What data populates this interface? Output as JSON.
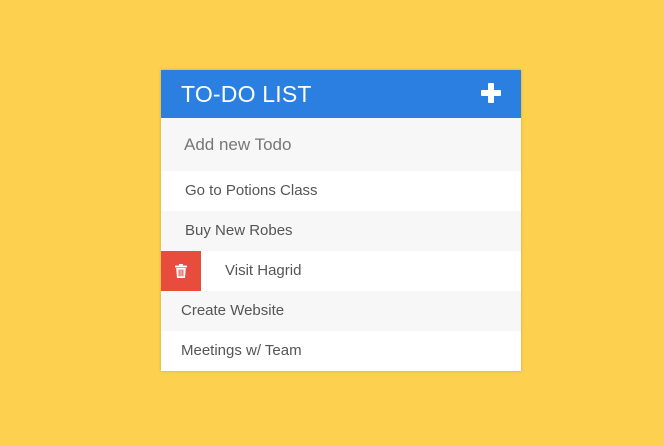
{
  "header": {
    "title": "TO-DO LIST",
    "add_icon": "plus-icon"
  },
  "input": {
    "placeholder": "Add new Todo",
    "value": ""
  },
  "todos": [
    {
      "text": "Go to Potions Class"
    },
    {
      "text": "Buy New Robes"
    },
    {
      "text": "Visit Hagrid",
      "delete_revealed": true,
      "delete_icon": "trash-icon"
    },
    {
      "text": "Create Website"
    },
    {
      "text": "Meetings w/ Team"
    }
  ],
  "colors": {
    "background": "#FDD04F",
    "header": "#2A7FE0",
    "delete": "#E74C3C",
    "row_alt": "#F7F7F7",
    "text": "#555555"
  }
}
